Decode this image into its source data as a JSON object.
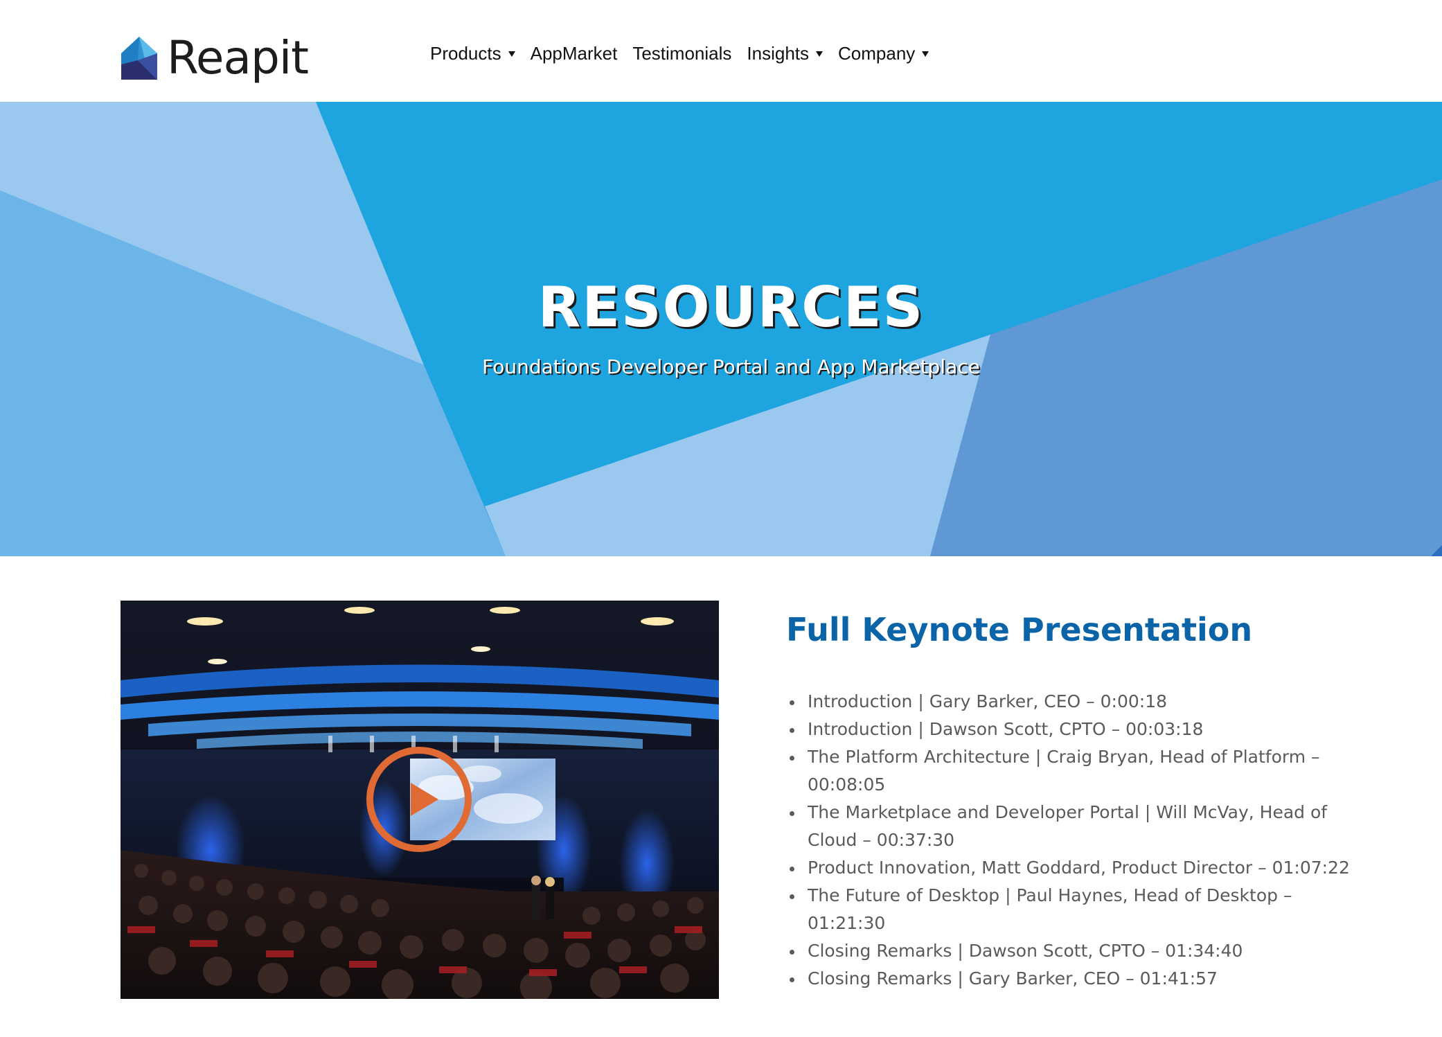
{
  "brand": {
    "name": "Reapit",
    "icon": "house-logo-icon"
  },
  "nav": {
    "items": [
      {
        "label": "Products",
        "has_dropdown": true
      },
      {
        "label": "AppMarket",
        "has_dropdown": false
      },
      {
        "label": "Testimonials",
        "has_dropdown": false
      },
      {
        "label": "Insights",
        "has_dropdown": true
      },
      {
        "label": "Company",
        "has_dropdown": true
      }
    ],
    "dropdown_icon": "caret-down-icon"
  },
  "hero": {
    "title": "RESOURCES",
    "subtitle": "Foundations Developer Portal and App Marketplace"
  },
  "video": {
    "thumbnail": "conference-auditorium-image",
    "play_icon": "play-icon"
  },
  "keynote": {
    "title": "Full Keynote Presentation",
    "items": [
      "Introduction | Gary Barker, CEO – 0:00:18",
      "Introduction | Dawson Scott, CPTO – 00:03:18",
      "The Platform Architecture | Craig Bryan, Head of Platform – 00:08:05",
      "The Marketplace and Developer Portal | Will McVay, Head of Cloud – 00:37:30",
      "Product Innovation, Matt Goddard, Product Director – 01:07:22",
      "The Future of Desktop | Paul Haynes, Head of Desktop – 01:21:30",
      "Closing Remarks | Dawson Scott, CPTO – 01:34:40",
      "Closing Remarks | Gary Barker, CEO – 01:41:57"
    ]
  },
  "colors": {
    "accent_blue": "#0b64a7",
    "hero_primary": "#1ea4df",
    "hero_light": "#9ac8ef",
    "hero_mid": "#6cb5e8",
    "hero_dark": "#5f98d4",
    "play_orange": "#e06a33",
    "body_text": "#5a5a5a"
  }
}
